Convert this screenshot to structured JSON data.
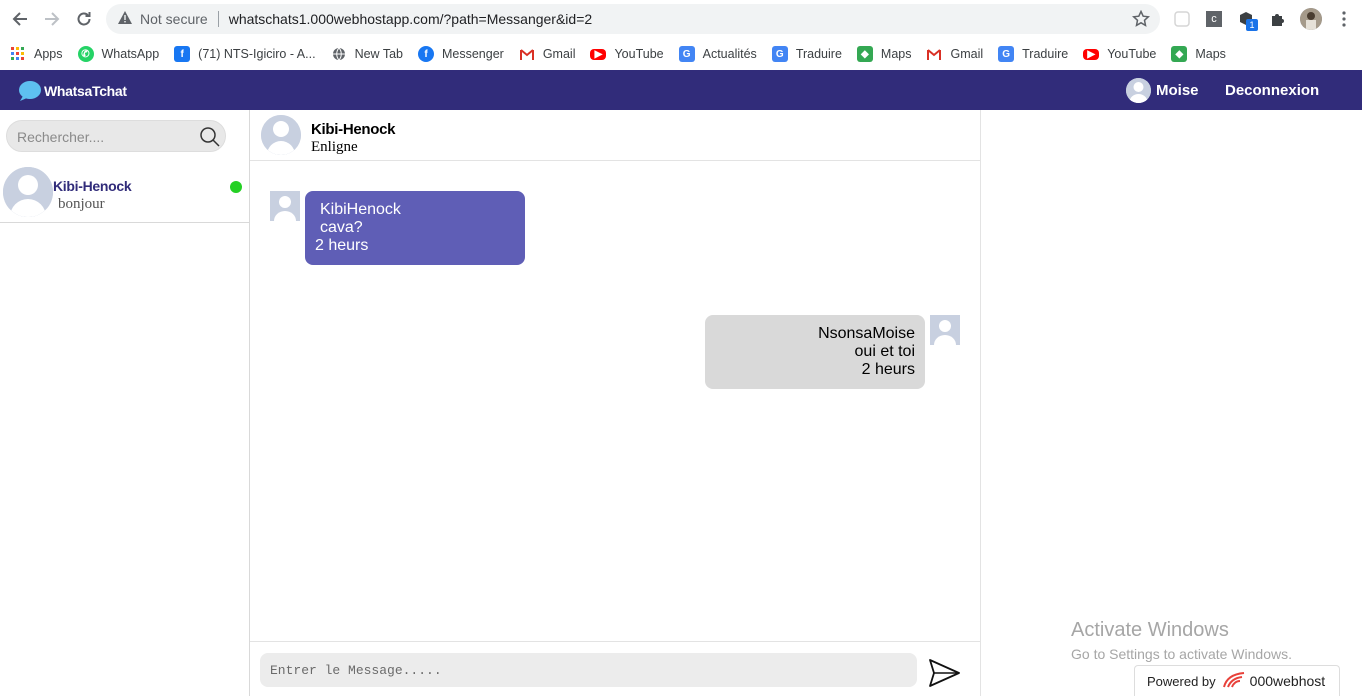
{
  "browser": {
    "not_secure": "Not secure",
    "url": "whatschats1.000webhostapp.com/?path=Messanger&id=2",
    "ext_badge": "1",
    "ext_letter": "c"
  },
  "bookmarks": [
    {
      "label": "Apps",
      "icon": "apps-grid-icon",
      "color": "#5f6368"
    },
    {
      "label": "WhatsApp",
      "icon": "whatsapp-icon",
      "color": "#25d366"
    },
    {
      "label": "(71) NTS-Igiciro - A...",
      "icon": "facebook-icon",
      "color": "#1877f2"
    },
    {
      "label": "New Tab",
      "icon": "globe-icon",
      "color": "#5f6368"
    },
    {
      "label": "Messenger",
      "icon": "facebook-icon",
      "color": "#1877f2"
    },
    {
      "label": "Gmail",
      "icon": "gmail-icon",
      "color": "#d93025"
    },
    {
      "label": "YouTube",
      "icon": "youtube-icon",
      "color": "#ff0000"
    },
    {
      "label": "Actualités",
      "icon": "news-icon",
      "color": "#4285f4"
    },
    {
      "label": "Traduire",
      "icon": "translate-icon",
      "color": "#4285f4"
    },
    {
      "label": "Maps",
      "icon": "maps-icon",
      "color": "#34a853"
    },
    {
      "label": "Gmail",
      "icon": "gmail-icon",
      "color": "#d93025"
    },
    {
      "label": "Traduire",
      "icon": "translate-icon",
      "color": "#4285f4"
    },
    {
      "label": "YouTube",
      "icon": "youtube-icon",
      "color": "#ff0000"
    },
    {
      "label": "Maps",
      "icon": "maps-icon",
      "color": "#34a853"
    }
  ],
  "header": {
    "logo": "WhatsaTchat",
    "user": "Moise",
    "logout": "Deconnexion",
    "bg": "#312c7a"
  },
  "sidebar": {
    "search_placeholder": "Rechercher....",
    "contacts": [
      {
        "name": "Kibi-Henock",
        "last": "bonjour",
        "online": true
      }
    ]
  },
  "chat": {
    "name": "Kibi-Henock",
    "status": "Enligne",
    "messages": [
      {
        "sender": "KibiHenock",
        "text": "cava?",
        "time": "2 heurs",
        "direction": "in"
      },
      {
        "sender": "NsonsaMoise",
        "text": "oui et toi",
        "time": "2 heurs",
        "direction": "out"
      }
    ],
    "input_placeholder": "Entrer le Message....."
  },
  "overlay": {
    "activate_title": "Activate Windows",
    "activate_sub": "Go to Settings to activate Windows.",
    "powered_by": "Powered by",
    "brand": "000webhost"
  }
}
